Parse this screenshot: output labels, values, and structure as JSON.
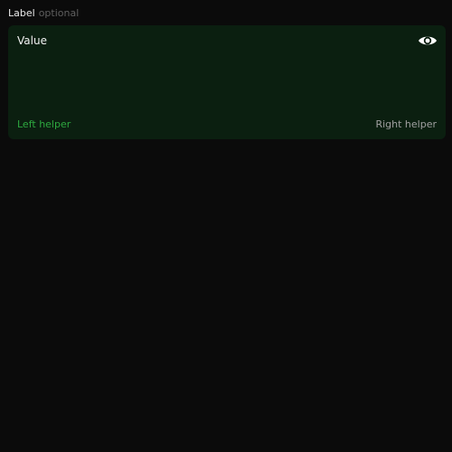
{
  "field": {
    "label": "Label",
    "optional": "optional",
    "value": "Value",
    "helper_left": "Left helper",
    "helper_right": "Right helper",
    "toggle_icon": "eye-icon"
  },
  "colors": {
    "background": "#0b0b0b",
    "field_background": "#0b1f10",
    "label": "#e9e9e9",
    "optional": "#5f5f5f",
    "value": "#f1f1f1",
    "helper_left": "#2da83f",
    "helper_right": "#a0a0a0",
    "icon": "#ffffff"
  }
}
